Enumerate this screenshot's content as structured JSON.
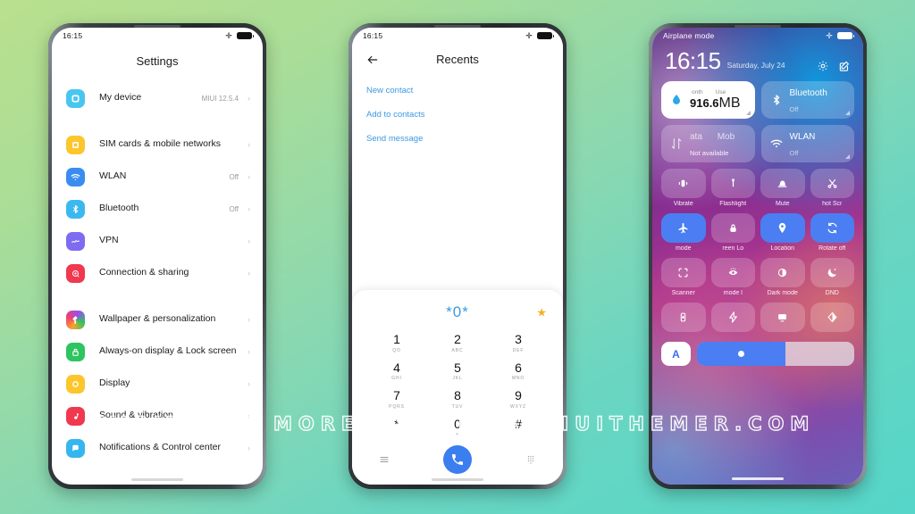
{
  "watermark": "VISIT FOR MORE THEMES - MIUITHEMER.COM",
  "settings_phone": {
    "statusbar": {
      "time": "16:15"
    },
    "title": "Settings",
    "rows": [
      {
        "label": "My device",
        "value": "MIUI 12.5.4",
        "icon": "device-icon",
        "color": "#49c6f0"
      },
      {
        "label": "SIM cards & mobile networks",
        "value": "",
        "icon": "sim-card-icon",
        "color": "#fcc62c"
      },
      {
        "label": "WLAN",
        "value": "Off",
        "icon": "wifi-icon",
        "color": "#3b8cf0"
      },
      {
        "label": "Bluetooth",
        "value": "Off",
        "icon": "bluetooth-icon",
        "color": "#3bb9ef"
      },
      {
        "label": "VPN",
        "value": "",
        "icon": "vpn-icon",
        "color": "#7d6cf2"
      },
      {
        "label": "Connection & sharing",
        "value": "",
        "icon": "connection-sharing-icon",
        "color": "#f0384f"
      },
      {
        "label": "Wallpaper & personalization",
        "value": "",
        "icon": "wallpaper-icon",
        "color": "#e84a8a"
      },
      {
        "label": "Always-on display & Lock screen",
        "value": "",
        "icon": "lock-icon",
        "color": "#2ec45f"
      },
      {
        "label": "Display",
        "value": "",
        "icon": "display-icon",
        "color": "#fcc62c"
      },
      {
        "label": "Sound & vibration",
        "value": "",
        "icon": "sound-icon",
        "color": "#f0384f"
      },
      {
        "label": "Notifications & Control center",
        "value": "",
        "icon": "notifications-icon",
        "color": "#35b6ef"
      }
    ]
  },
  "dialer_phone": {
    "statusbar": {
      "time": "16:15"
    },
    "title": "Recents",
    "actions": [
      "New contact",
      "Add to contacts",
      "Send message"
    ],
    "dialed_number": "*0*",
    "keypad": [
      {
        "digit": "1",
        "letters": "QO"
      },
      {
        "digit": "2",
        "letters": "ABC"
      },
      {
        "digit": "3",
        "letters": "DEF"
      },
      {
        "digit": "4",
        "letters": "GHI"
      },
      {
        "digit": "5",
        "letters": "JKL"
      },
      {
        "digit": "6",
        "letters": "MNO"
      },
      {
        "digit": "7",
        "letters": "PQRS"
      },
      {
        "digit": "8",
        "letters": "TUV"
      },
      {
        "digit": "9",
        "letters": "WXYZ"
      },
      {
        "digit": "*",
        "letters": ""
      },
      {
        "digit": "0",
        "letters": "+"
      },
      {
        "digit": "#",
        "letters": ""
      }
    ],
    "call_button_color": "#3b7ef0",
    "accent_color": "#3a9ae0"
  },
  "control_phone": {
    "statusbar": {
      "label": "Airplane mode"
    },
    "time": "16:15",
    "date": "Saturday, July 24",
    "cards": [
      {
        "type": "data-usage",
        "top_left": "onth",
        "top_right": "Use",
        "amount": "916.6",
        "unit": "MB"
      },
      {
        "type": "toggle",
        "title": "Bluetooth",
        "sub": "Off",
        "icon": "bluetooth-icon"
      },
      {
        "type": "mobile-data",
        "title_left": "ata",
        "title_right": "Mob",
        "sub": "Not available",
        "icon": "data-transfer-icon"
      },
      {
        "type": "toggle",
        "title": "WLAN",
        "sub": "Off",
        "icon": "wifi-icon"
      }
    ],
    "tiles": [
      {
        "label": "Vibrate",
        "icon": "vibrate-icon",
        "on": false
      },
      {
        "label": "Flashlight",
        "icon": "flashlight-icon",
        "on": false
      },
      {
        "label": "Mute",
        "icon": "mute-bell-icon",
        "on": false
      },
      {
        "label": "hot   Scr",
        "icon": "scissors-icon",
        "on": false
      },
      {
        "label": "mode",
        "icon": "airplane-icon",
        "on": true
      },
      {
        "label": "reen    Lo",
        "icon": "lock-icon",
        "on": false
      },
      {
        "label": "Location",
        "icon": "location-pin-icon",
        "on": true
      },
      {
        "label": "Rotate off",
        "icon": "rotate-icon",
        "on": true
      },
      {
        "label": "Scanner",
        "icon": "scanner-icon",
        "on": false
      },
      {
        "label": "mode     l",
        "icon": "eye-icon",
        "on": false
      },
      {
        "label": "Dark mode",
        "icon": "dark-mode-icon",
        "on": false
      },
      {
        "label": "DND",
        "icon": "moon-icon",
        "on": false
      },
      {
        "label": "",
        "icon": "battery-saver-icon",
        "on": false
      },
      {
        "label": "",
        "icon": "bolt-icon",
        "on": false
      },
      {
        "label": "",
        "icon": "cast-screen-icon",
        "on": false
      },
      {
        "label": "",
        "icon": "contrast-icon",
        "on": false
      }
    ],
    "brightness": {
      "auto_label": "A",
      "fill_percent": 56
    },
    "accent_color": "#4a7ef2"
  }
}
